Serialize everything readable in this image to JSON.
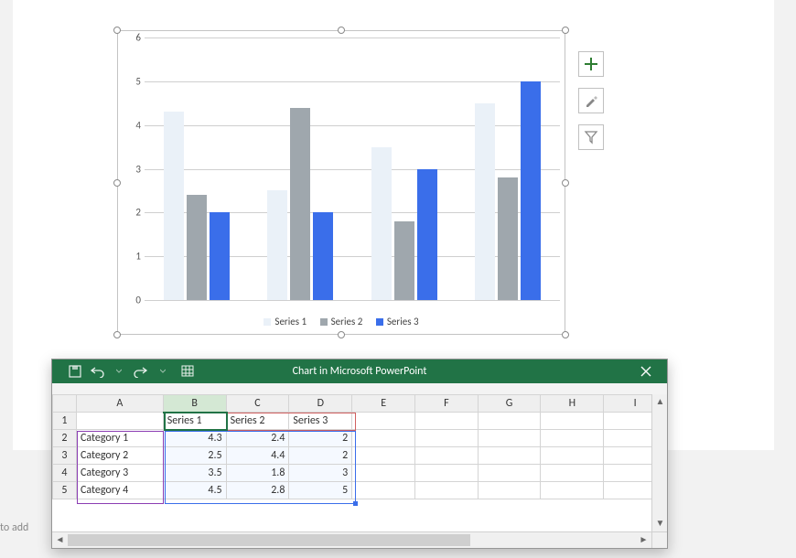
{
  "chart_data": {
    "type": "bar",
    "categories": [
      "Category 1",
      "Category 2",
      "Category 3",
      "Category 4"
    ],
    "series": [
      {
        "name": "Series 1",
        "values": [
          4.3,
          2.5,
          3.5,
          4.5
        ]
      },
      {
        "name": "Series 2",
        "values": [
          2.4,
          4.4,
          1.8,
          2.8
        ]
      },
      {
        "name": "Series 3",
        "values": [
          2,
          2,
          3,
          5
        ]
      }
    ],
    "ylim": [
      0,
      6
    ],
    "ytick_labels": [
      "0",
      "1",
      "2",
      "3",
      "4",
      "5",
      "6"
    ],
    "colors": {
      "Series 1": "#eaf1f8",
      "Series 2": "#9fa7ad",
      "Series 3": "#3a6eea"
    },
    "legend_position": "bottom"
  },
  "legend": {
    "s1": "Series 1",
    "s2": "Series 2",
    "s3": "Series 3"
  },
  "side_buttons": {
    "elements": "chart-elements",
    "styles": "chart-styles",
    "filter": "chart-filters"
  },
  "excel": {
    "title": "Chart in Microsoft PowerPoint",
    "columns": [
      "A",
      "B",
      "C",
      "D",
      "E",
      "F",
      "G",
      "H",
      "I"
    ],
    "rows": [
      "1",
      "2",
      "3",
      "4",
      "5"
    ],
    "header_row": {
      "A": "",
      "B": "Series 1",
      "C": "Series 2",
      "D": "Series 3"
    },
    "data_rows": [
      {
        "A": "Category 1",
        "B": "4.3",
        "C": "2.4",
        "D": "2"
      },
      {
        "A": "Category 2",
        "B": "2.5",
        "C": "4.4",
        "D": "2"
      },
      {
        "A": "Category 3",
        "B": "3.5",
        "C": "1.8",
        "D": "3"
      },
      {
        "A": "Category 4",
        "B": "4.5",
        "C": "2.8",
        "D": "5"
      }
    ],
    "selected_column": "B"
  },
  "footer_hint": "to add"
}
